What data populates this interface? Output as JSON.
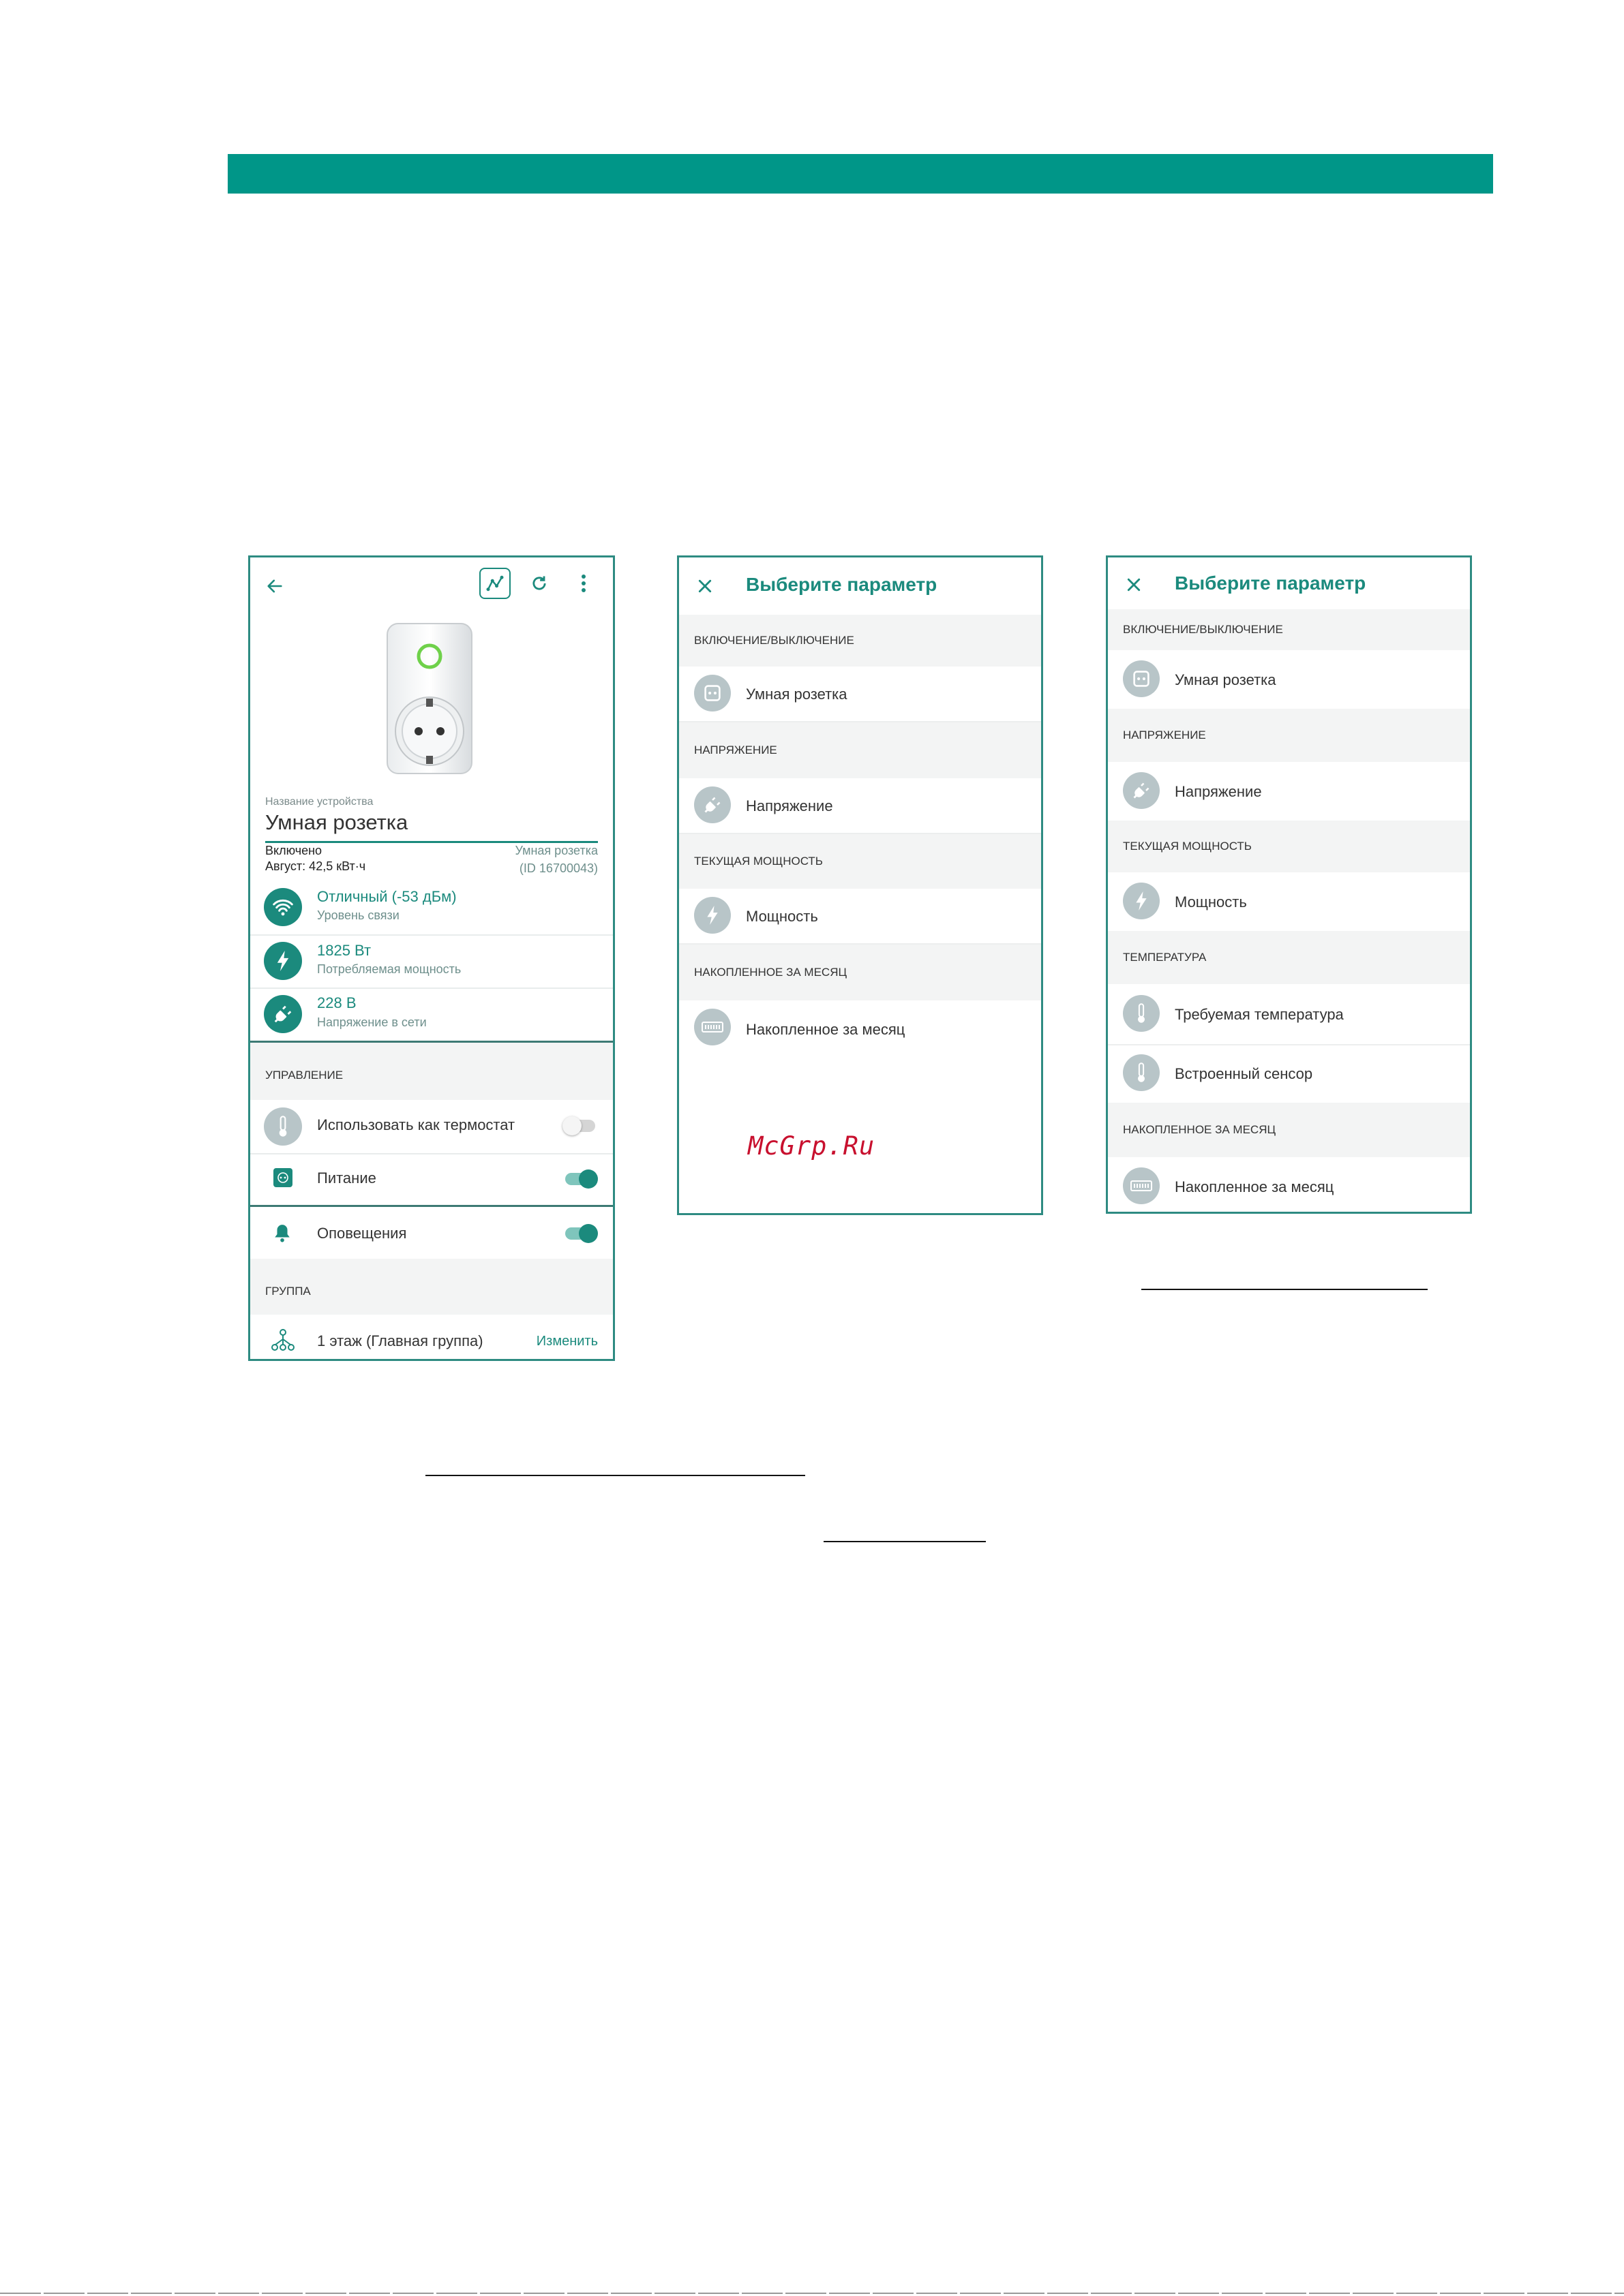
{
  "colors": {
    "accent": "#1b8a7d",
    "bar": "#009688",
    "border": "#2e8b82",
    "watermark": "#c8102e"
  },
  "watermark": "McGrp.Ru",
  "phone1": {
    "device_name_label": "Название устройства",
    "device_name": "Умная розетка",
    "status": "Включено",
    "energy": "Август: 42,5 кВт·ч",
    "device_type": "Умная розетка",
    "device_id": "(ID 16700043)",
    "metrics": [
      {
        "icon": "wifi-icon",
        "value": "Отличный (-53 дБм)",
        "label": "Уровень связи"
      },
      {
        "icon": "lightning-icon",
        "value": "1825 Вт",
        "label": "Потребляемая мощность"
      },
      {
        "icon": "plug-icon",
        "value": "228 В",
        "label": "Напряжение в сети"
      }
    ],
    "control_header": "УПРАВЛЕНИЕ",
    "thermostat_label": "Использовать как термостат",
    "thermostat_on": false,
    "power_label": "Питание",
    "power_on": true,
    "alerts_label": "Оповещения",
    "alerts_on": true,
    "group_header": "ГРУППА",
    "group_value": "1 этаж (Главная группа)",
    "group_action": "Изменить"
  },
  "phone2": {
    "title": "Выберите параметр",
    "sections": [
      {
        "header": "ВКЛЮЧЕНИЕ/ВЫКЛЮЧЕНИЕ",
        "items": [
          {
            "icon": "socket-icon",
            "label": "Умная розетка"
          }
        ]
      },
      {
        "header": "НАПРЯЖЕНИЕ",
        "items": [
          {
            "icon": "plug-icon",
            "label": "Напряжение"
          }
        ]
      },
      {
        "header": "ТЕКУЩАЯ МОЩНОСТЬ",
        "items": [
          {
            "icon": "lightning-icon",
            "label": "Мощность"
          }
        ]
      },
      {
        "header": "НАКОПЛЕННОЕ ЗА МЕСЯЦ",
        "items": [
          {
            "icon": "meter-icon",
            "label": "Накопленное за месяц"
          }
        ]
      }
    ]
  },
  "phone3": {
    "title": "Выберите параметр",
    "sections": [
      {
        "header": "ВКЛЮЧЕНИЕ/ВЫКЛЮЧЕНИЕ",
        "items": [
          {
            "icon": "socket-icon",
            "label": "Умная розетка"
          }
        ]
      },
      {
        "header": "НАПРЯЖЕНИЕ",
        "items": [
          {
            "icon": "plug-icon",
            "label": "Напряжение"
          }
        ]
      },
      {
        "header": "ТЕКУЩАЯ МОЩНОСТЬ",
        "items": [
          {
            "icon": "lightning-icon",
            "label": "Мощность"
          }
        ]
      },
      {
        "header": "ТЕМПЕРАТУРА",
        "items": [
          {
            "icon": "thermometer-icon",
            "label": "Требуемая температура"
          },
          {
            "icon": "thermometer-icon",
            "label": "Встроенный сенсор"
          }
        ]
      },
      {
        "header": "НАКОПЛЕННОЕ ЗА МЕСЯЦ",
        "items": [
          {
            "icon": "meter-icon",
            "label": "Накопленное за месяц"
          }
        ]
      }
    ]
  }
}
